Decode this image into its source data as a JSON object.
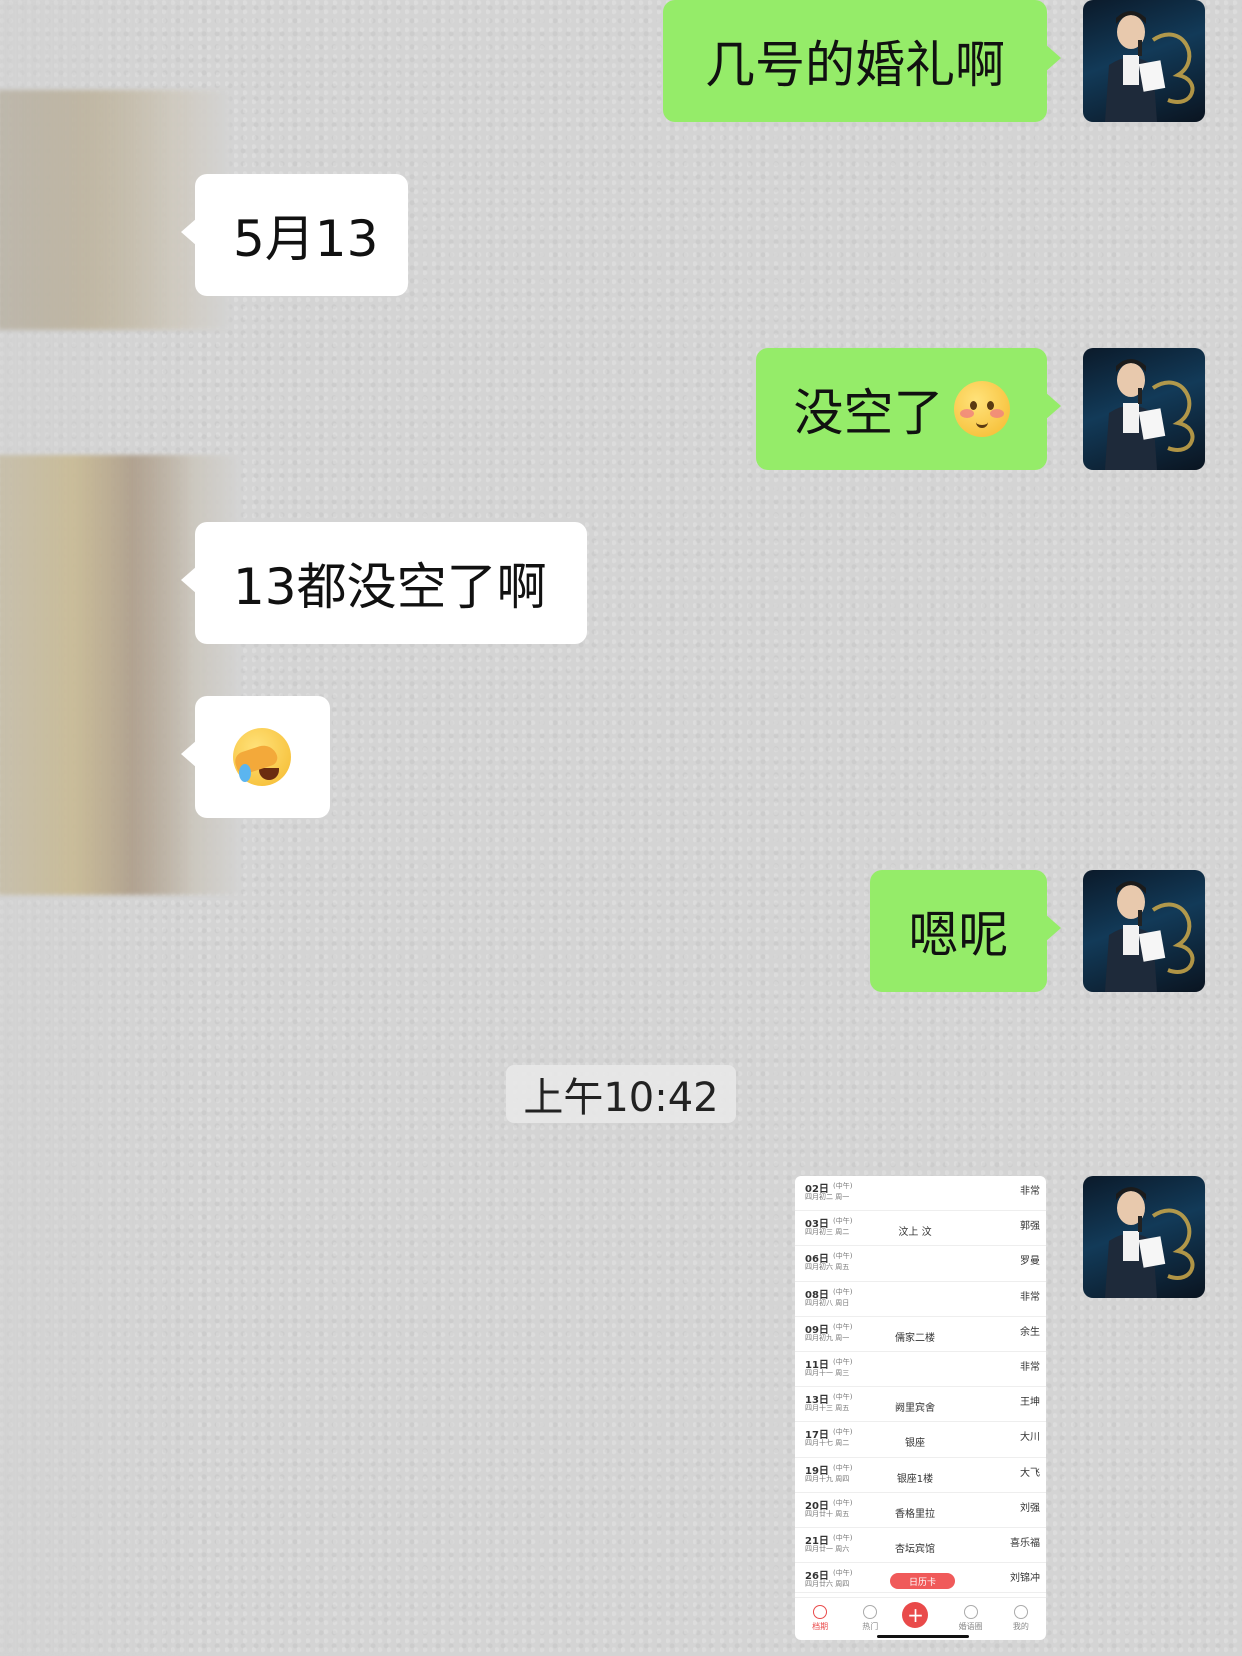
{
  "messages": [
    {
      "id": "m1",
      "direction": "outgoing",
      "text": "几号的婚礼啊"
    },
    {
      "id": "m2",
      "direction": "incoming",
      "text": "5月13"
    },
    {
      "id": "m3",
      "direction": "outgoing",
      "text": "没空了",
      "emoji": "smiling-blush-emoji"
    },
    {
      "id": "m4",
      "direction": "incoming",
      "text": "13都没空了啊"
    },
    {
      "id": "m5",
      "direction": "incoming",
      "text": "",
      "emoji": "facepalm-emoji"
    },
    {
      "id": "m6",
      "direction": "outgoing",
      "text": "嗯呢"
    }
  ],
  "timestamp": "上午10:42",
  "screenshot": {
    "rows": [
      {
        "date": "02日",
        "noon": "(中午)",
        "lunar": "四月初二 周一",
        "venue": "",
        "name": "非常"
      },
      {
        "date": "03日",
        "noon": "(中午)",
        "lunar": "四月初三 周二",
        "venue": "汶上 汶",
        "name": "郭强"
      },
      {
        "date": "06日",
        "noon": "(中午)",
        "lunar": "四月初六 周五",
        "venue": "",
        "name": "罗曼"
      },
      {
        "date": "08日",
        "noon": "(中午)",
        "lunar": "四月初八 周日",
        "venue": "",
        "name": "非常"
      },
      {
        "date": "09日",
        "noon": "(中午)",
        "lunar": "四月初九 周一",
        "venue": "儒家二楼",
        "name": "余生"
      },
      {
        "date": "11日",
        "noon": "(中午)",
        "lunar": "四月十一 周三",
        "venue": "",
        "name": "非常"
      },
      {
        "date": "13日",
        "noon": "(中午)",
        "lunar": "四月十三 周五",
        "venue": "阙里宾舍",
        "name": "王坤"
      },
      {
        "date": "17日",
        "noon": "(中午)",
        "lunar": "四月十七 周二",
        "venue": "银座",
        "name": "大川"
      },
      {
        "date": "19日",
        "noon": "(中午)",
        "lunar": "四月十九 周四",
        "venue": "银座1楼",
        "name": "大飞"
      },
      {
        "date": "20日",
        "noon": "(中午)",
        "lunar": "四月廿十 周五",
        "venue": "香格里拉",
        "name": "刘强"
      },
      {
        "date": "21日",
        "noon": "(中午)",
        "lunar": "四月廿一 周六",
        "venue": "杏坛宾馆",
        "name": "喜乐福"
      },
      {
        "date": "26日",
        "noon": "(中午)",
        "lunar": "四月廿六 周四",
        "venue": "",
        "badge": "日历卡",
        "name": "刘锦冲"
      }
    ],
    "nav": [
      {
        "label": "档期",
        "icon": "clock-icon",
        "active": true
      },
      {
        "label": "热门",
        "icon": "hot-icon",
        "active": false
      },
      {
        "label": "",
        "icon": "plus-icon",
        "active": false
      },
      {
        "label": "婚语圈",
        "icon": "planet-icon",
        "active": false
      },
      {
        "label": "我的",
        "icon": "profile-icon",
        "active": false
      }
    ]
  },
  "colors": {
    "outgoing_bubble": "#95ec69",
    "incoming_bubble": "#ffffff",
    "accent_red": "#e94a4a"
  }
}
